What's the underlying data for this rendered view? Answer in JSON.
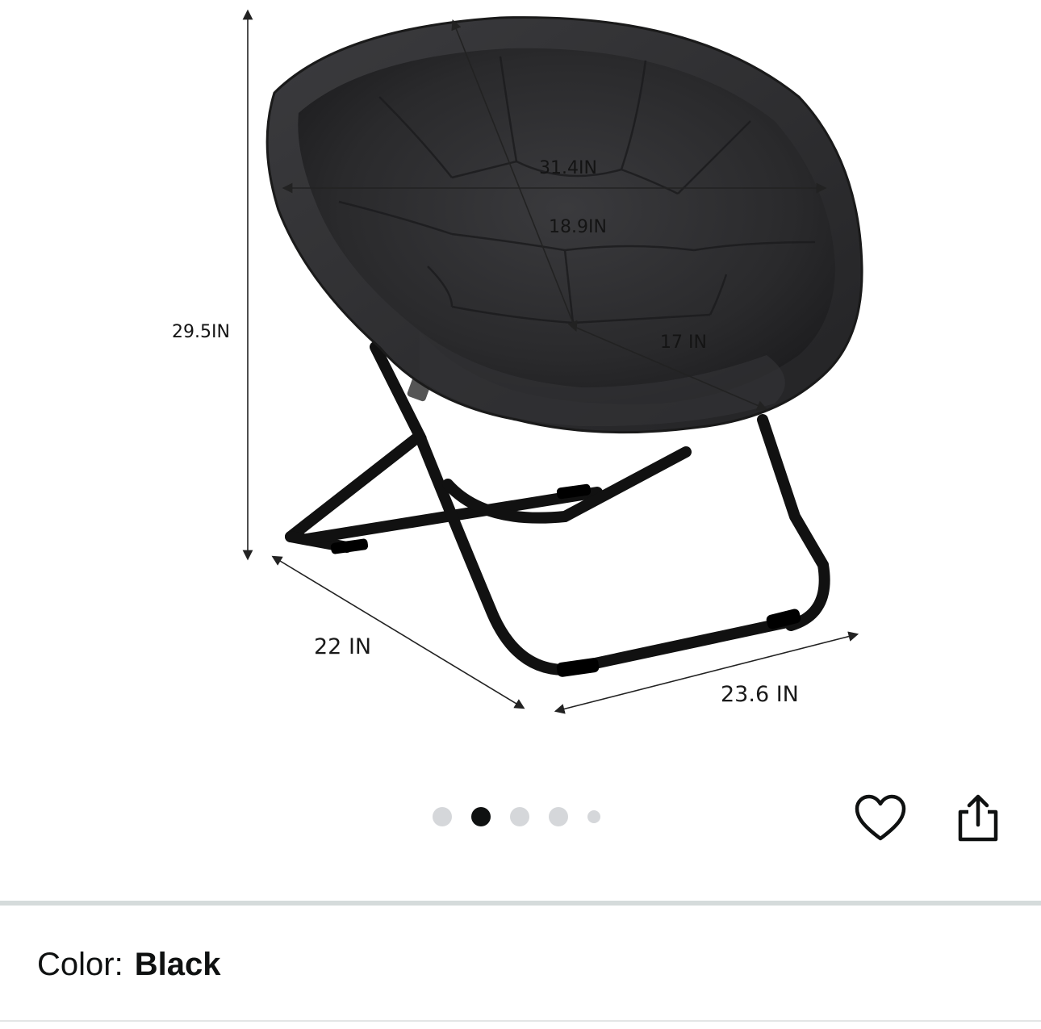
{
  "product_image": {
    "dimensions": {
      "height": "29.5IN",
      "width_top": "31.4IN",
      "seat_depth": "18.9IN",
      "seat_width": "17 IN",
      "depth": "22 IN",
      "base_width": "23.6 IN"
    }
  },
  "carousel": {
    "dots": [
      {
        "active": false,
        "size": "normal"
      },
      {
        "active": true,
        "size": "normal"
      },
      {
        "active": false,
        "size": "normal"
      },
      {
        "active": false,
        "size": "normal"
      },
      {
        "active": false,
        "size": "small"
      }
    ]
  },
  "actions": {
    "favorite_icon": "heart-icon",
    "share_icon": "share-icon"
  },
  "variation": {
    "label": "Color:",
    "value": "Black"
  },
  "colors": {
    "chair_fabric": "#2c2c2e",
    "frame": "#111111",
    "dot_active": "#0f1111",
    "dot_inactive": "#d5d7da",
    "divider": "#d5dbdb"
  }
}
